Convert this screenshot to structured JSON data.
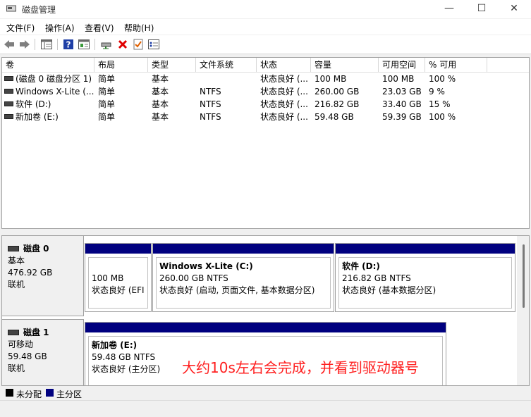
{
  "window": {
    "title": "磁盘管理",
    "minimize": "—",
    "maximize": "☐",
    "close": "✕"
  },
  "menu": [
    "文件(F)",
    "操作(A)",
    "查看(V)",
    "帮助(H)"
  ],
  "toolbar": [
    {
      "name": "back-arrow-icon"
    },
    {
      "name": "forward-arrow-icon"
    },
    {
      "name": "console-tree-icon"
    },
    {
      "name": "help-icon"
    },
    {
      "name": "properties-icon"
    },
    {
      "name": "connect-drive-icon"
    },
    {
      "name": "delete-icon"
    },
    {
      "name": "check-icon"
    },
    {
      "name": "settings-list-icon"
    }
  ],
  "table": {
    "columns": [
      "卷",
      "布局",
      "类型",
      "文件系统",
      "状态",
      "容量",
      "可用空间",
      "% 可用"
    ],
    "rows": [
      [
        "(磁盘 0 磁盘分区 1)",
        "简单",
        "基本",
        "",
        "状态良好 (...",
        "100 MB",
        "100 MB",
        "100 %"
      ],
      [
        "Windows X-Lite (...",
        "简单",
        "基本",
        "NTFS",
        "状态良好 (...",
        "260.00 GB",
        "23.03 GB",
        "9 %"
      ],
      [
        "软件 (D:)",
        "简单",
        "基本",
        "NTFS",
        "状态良好 (...",
        "216.82 GB",
        "33.40 GB",
        "15 %"
      ],
      [
        "新加卷 (E:)",
        "简单",
        "基本",
        "NTFS",
        "状态良好 (...",
        "59.48 GB",
        "59.39 GB",
        "100 %"
      ]
    ]
  },
  "disks": [
    {
      "name": "磁盘 0",
      "type": "基本",
      "size": "476.92 GB",
      "status": "联机",
      "partitions": [
        {
          "name": "",
          "size": "100 MB",
          "status": "状态良好 (EFI 系"
        },
        {
          "name": "Windows X-Lite  (C:)",
          "size": "260.00 GB NTFS",
          "status": "状态良好 (启动, 页面文件, 基本数据分区)"
        },
        {
          "name": "软件  (D:)",
          "size": "216.82 GB NTFS",
          "status": "状态良好 (基本数据分区)"
        }
      ]
    },
    {
      "name": "磁盘 1",
      "type": "可移动",
      "size": "59.48 GB",
      "status": "联机",
      "partitions": [
        {
          "name": "新加卷  (E:)",
          "size": "59.48 GB NTFS",
          "status": "状态良好 (主分区)"
        }
      ]
    }
  ],
  "annotation": "大约10s左右会完成，并看到驱动器号",
  "legend": [
    {
      "label": "未分配",
      "color": "#000000"
    },
    {
      "label": "主分区",
      "color": "#00007f"
    }
  ]
}
